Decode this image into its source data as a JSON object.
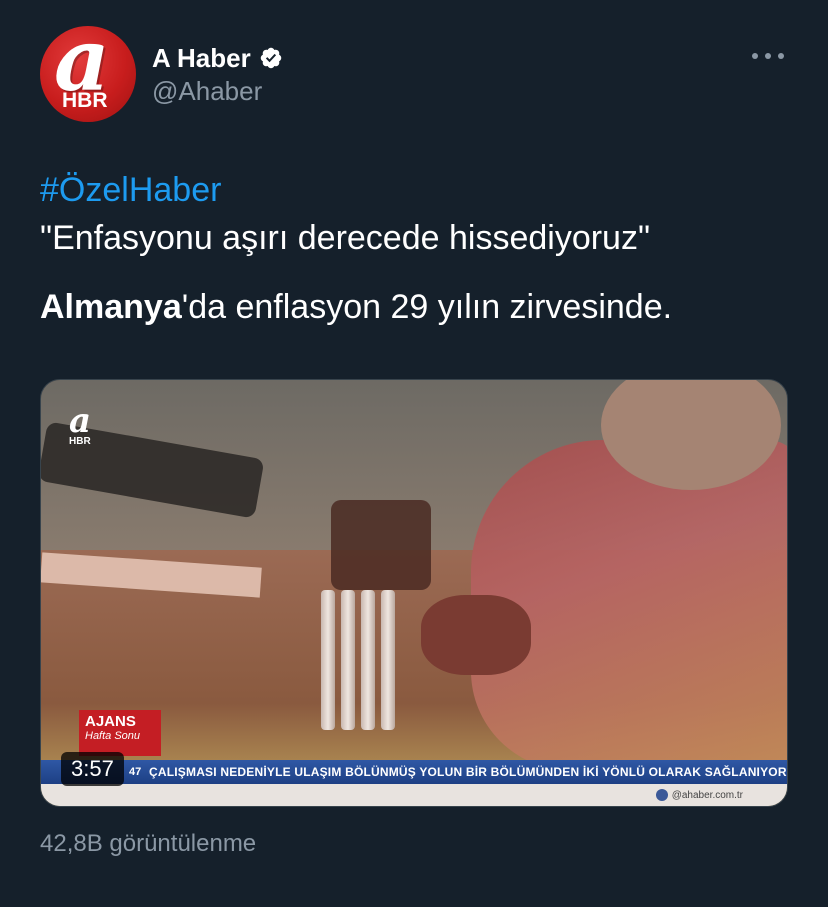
{
  "account": {
    "display_name": "A Haber",
    "handle": "@Ahaber",
    "avatar_letter": "a",
    "avatar_text": "HBR",
    "verified": true,
    "verified_icon": "verified-badge-icon",
    "more_icon": "more-options-icon"
  },
  "tweet": {
    "hashtag": "#ÖzelHaber",
    "quote": "\"Enfasyonu aşırı derecede hissediyoruz\"",
    "bold_word": "Almanya",
    "rest": "'da enflasyon 29 yılın zirvesinde."
  },
  "video": {
    "duration": "3:57",
    "channel_logo_letter": "a",
    "channel_logo_text": "HBR",
    "program_name": "AJANS",
    "program_sub": "Hafta Sonu",
    "ticker_prefix": "47",
    "ticker_text": "ÇALIŞMASI NEDENİYLE ULAŞIM BÖLÜNMÜŞ YOLUN BİR BÖLÜMÜNDEN İKİ YÖNLÜ OLARAK SAĞLANIYOR",
    "site": "@ahaber.com.tr"
  },
  "stats": {
    "views": "42,8B görüntülenme"
  },
  "colors": {
    "background": "#15202b",
    "link": "#1d9bf0",
    "secondary_text": "#8b98a5",
    "brand_red": "#c81d1d"
  }
}
